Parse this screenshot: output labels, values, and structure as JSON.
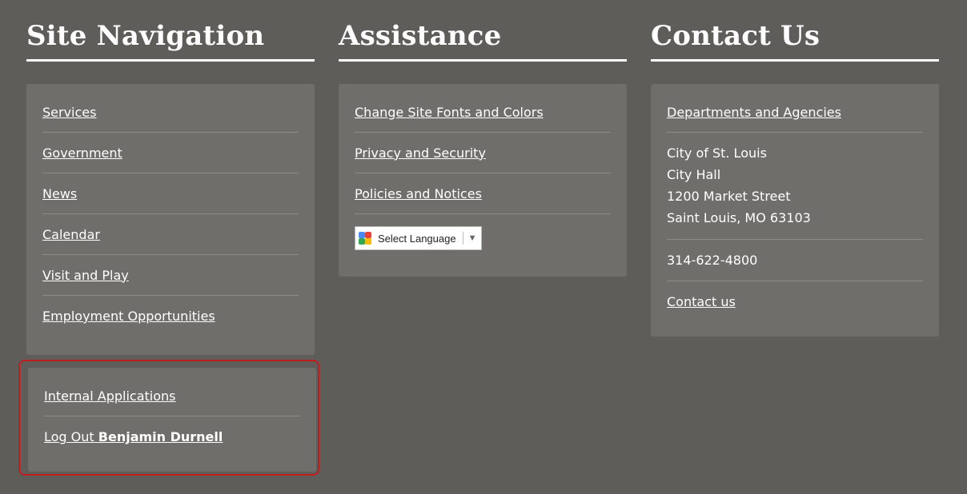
{
  "site_navigation": {
    "title": "Site Navigation",
    "links": [
      "Services",
      "Government",
      "News",
      "Calendar",
      "Visit and Play",
      "Employment Opportunities"
    ]
  },
  "internal": {
    "internal_apps": "Internal Applications",
    "logout_prefix": "Log Out",
    "user_name": "Benjamin Durnell",
    "highlight_color": "#c01d1d"
  },
  "assistance": {
    "title": "Assistance",
    "links": [
      "Change Site Fonts and Colors",
      "Privacy and Security",
      "Policies and Notices"
    ],
    "language_select": {
      "label": "Select Language",
      "icon": "google-translate-icon",
      "arrow": "▼"
    }
  },
  "contact": {
    "title": "Contact Us",
    "departments_link": "Departments and Agencies",
    "address_lines": [
      "City of St. Louis",
      "City Hall",
      "1200 Market Street",
      "Saint Louis, MO 63103"
    ],
    "phone": "314-622-4800",
    "contact_link": "Contact us"
  },
  "colors": {
    "background": "#5f5d5a",
    "panel": "#706e6b",
    "text": "#ffffff"
  }
}
